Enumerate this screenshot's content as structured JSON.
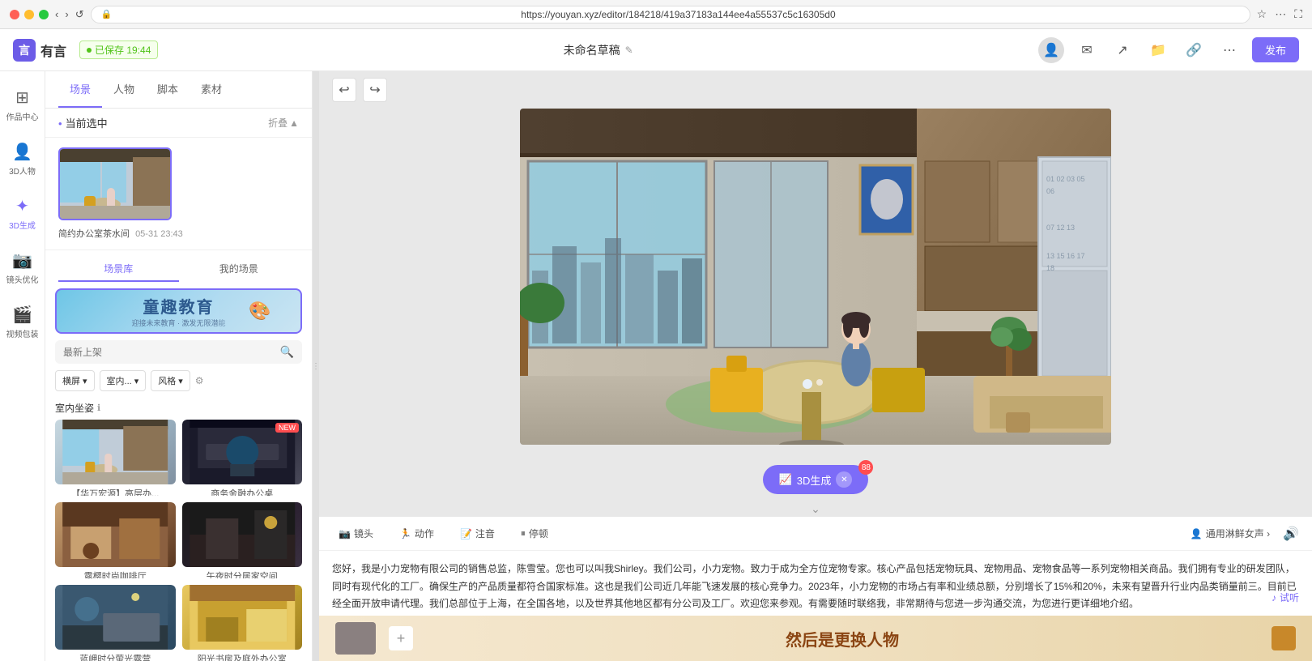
{
  "browser": {
    "url": "https://youyan.xyz/editor/184218/419a37183a144ee4a55537c5c16305d0",
    "back_title": "后退",
    "forward_title": "前进",
    "refresh_title": "刷新"
  },
  "app": {
    "logo_text": "有言",
    "save_status": "已保存 19:44",
    "project_title": "未命名草稿",
    "publish_label": "发布"
  },
  "left_sidebar": {
    "icons": [
      {
        "id": "works",
        "label": "作品中心",
        "icon": "⊞"
      },
      {
        "id": "3d-person",
        "label": "3D人物",
        "icon": "👤"
      },
      {
        "id": "3d-gen",
        "label": "3D生成",
        "icon": "✦",
        "active": true
      },
      {
        "id": "camera",
        "label": "镜头优化",
        "icon": "📷"
      },
      {
        "id": "video",
        "label": "视频包装",
        "icon": "🎬"
      }
    ]
  },
  "panel": {
    "tabs": [
      {
        "id": "scene",
        "label": "场景",
        "active": true
      },
      {
        "id": "character",
        "label": "人物"
      },
      {
        "id": "script",
        "label": "脚本"
      },
      {
        "id": "material",
        "label": "素材"
      }
    ],
    "current_section": {
      "label": "当前选中",
      "collapse_label": "折叠",
      "selected_scene_name": "简约办公室茶水间",
      "selected_scene_date": "05-31 23:43"
    },
    "library_tabs": [
      {
        "id": "lib",
        "label": "场景库",
        "active": true
      },
      {
        "id": "my",
        "label": "我的场景"
      }
    ],
    "banner_text": "童趣教育",
    "search_placeholder": "最新上架",
    "filters": [
      {
        "id": "orientation",
        "label": "横屏"
      },
      {
        "id": "indoor",
        "label": "室内..."
      },
      {
        "id": "style",
        "label": "风格"
      }
    ],
    "category_label": "室内坐姿",
    "scenes": [
      {
        "id": "s1",
        "label": "【华万宏源】高层办...",
        "color": "thumb-office1",
        "new": false
      },
      {
        "id": "s2",
        "label": "商务金融办公桌",
        "color": "thumb-office2",
        "new": true
      },
      {
        "id": "s3",
        "label": "露樱时尚咖啡厅",
        "color": "thumb-cafe",
        "new": false
      },
      {
        "id": "s4",
        "label": "午夜时分居家空间",
        "color": "thumb-night",
        "new": false
      },
      {
        "id": "s5",
        "label": "蓝岬时分萤光露营",
        "color": "thumb-outdoor",
        "new": false
      },
      {
        "id": "s6",
        "label": "阳光书房及庭外办公室",
        "color": "thumb-yellow",
        "new": false
      }
    ]
  },
  "canvas": {
    "current_scene": "简约办公室茶水间",
    "undo_label": "撤销",
    "redo_label": "重做"
  },
  "generate_btn": {
    "label": "3D生成",
    "badge": "88",
    "icon": "📈"
  },
  "editor": {
    "tools": [
      {
        "id": "camera",
        "label": "镜头",
        "icon": "📷"
      },
      {
        "id": "action",
        "label": "动作",
        "icon": "🏃"
      },
      {
        "id": "caption",
        "label": "注音",
        "icon": "📝"
      },
      {
        "id": "pause",
        "label": "停顿",
        "icon": "⏸"
      }
    ],
    "voice_label": "通用淋鲜女声 ›",
    "script_text": "您好，我是小力宠物有限公司的销售总监，陈雪莹。您也可以叫我Shirley。我们公司，小力宠物。致力于成为全方位宠物专家。核心产品包括宠物玩具、宠物用品、宠物食品等一系列宠物相关商品。我们拥有专业的研发团队，同时有现代化的工厂。确保生产的产品质量都符合国家标准。这也是我们公司近几年能飞速发展的核心竞争力。2023年，小力宠物的市场占有率和业绩总额，分别增长了15%和20%，未来有望晋升行业内品类销量前三。目前已经全面开放申请代理。我们总部位于上海，在全国各地，以及世界其他地区都有分公司及工厂。欢迎您来参观。有需要随时联络我，非常期待与您进一步沟通交流，为您进行更详细地介绍。",
    "tts_label": "♪ 试听"
  },
  "bottom_bar": {
    "title": "然后是更换人物",
    "add_label": "+"
  }
}
